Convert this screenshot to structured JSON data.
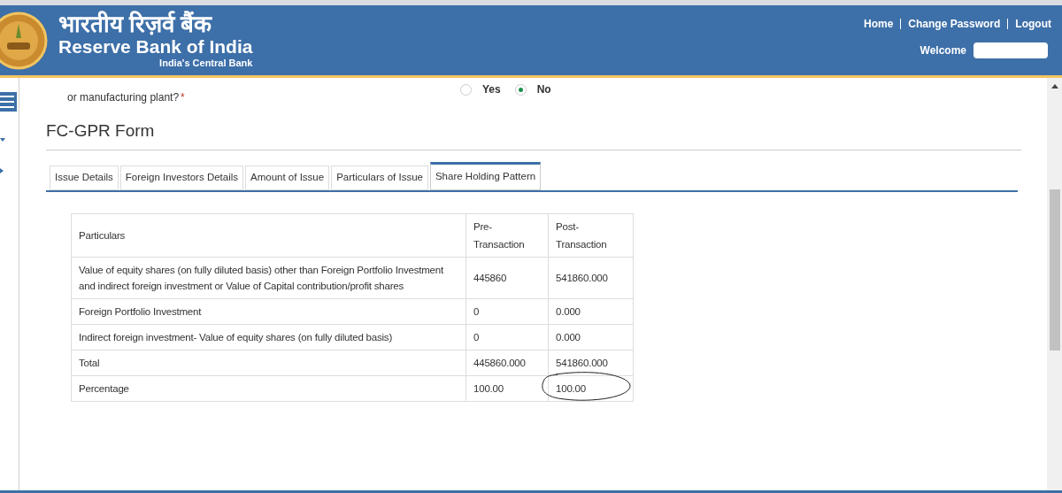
{
  "header": {
    "hindi_title": "भारतीय रिज़र्व बैंक",
    "title": "Reserve Bank of India",
    "tagline": "India's Central Bank",
    "nav": [
      "Home",
      "Change Password",
      "Logout"
    ],
    "welcome": "Welcome"
  },
  "question": {
    "lines": [
      "or manufacturing plant?"
    ],
    "required": "*",
    "options": [
      {
        "label": "Yes",
        "selected": false
      },
      {
        "label": "No",
        "selected": true
      }
    ]
  },
  "form_title": "FC-GPR Form",
  "tabs": [
    {
      "label": "Issue Details",
      "selected": false
    },
    {
      "label": "Foreign Investors Details",
      "selected": false
    },
    {
      "label": "Amount of Issue",
      "selected": false
    },
    {
      "label": "Particulars of Issue",
      "selected": false
    },
    {
      "label": "Share Holding Pattern",
      "selected": true
    }
  ],
  "table": {
    "columns": [
      "Particulars",
      "Pre-\nTransaction",
      "Post-\nTransaction"
    ],
    "rows": [
      [
        "Value of equity shares (on fully diluted basis) other than Foreign Portfolio Investment and indirect foreign investment or Value of Capital contribution/profit shares",
        "445860",
        "541860.000"
      ],
      [
        "Foreign Portfolio Investment",
        "0",
        "0.000"
      ],
      [
        "Indirect foreign investment- Value of equity shares (on fully diluted basis)",
        "0",
        "0.000"
      ],
      [
        "Total",
        "445860.000",
        "541860.000"
      ],
      [
        "Percentage",
        "100.00",
        "100.00"
      ]
    ]
  }
}
